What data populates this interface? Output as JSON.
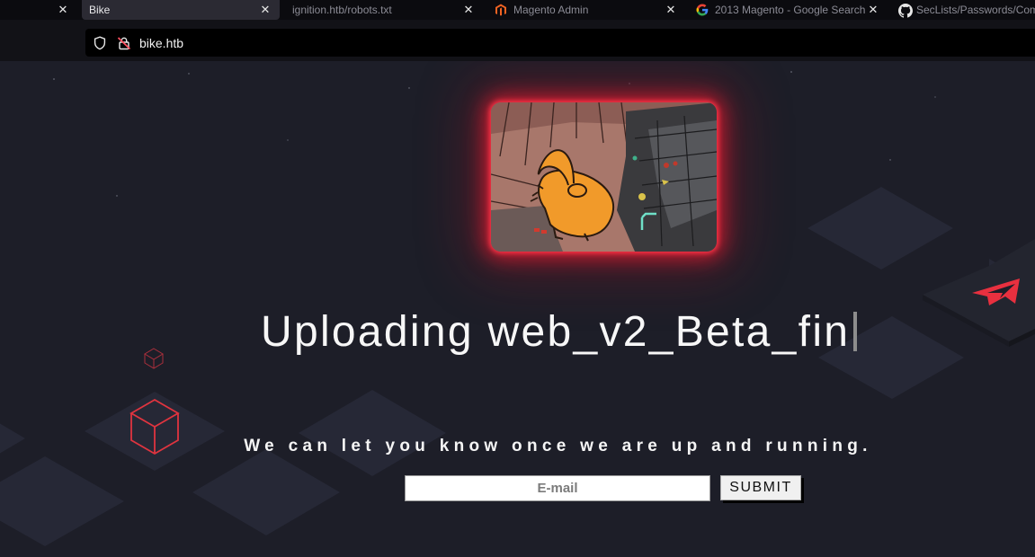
{
  "browser": {
    "tabs": [
      {
        "label": "Bike",
        "active": true,
        "favicon": "none"
      },
      {
        "label": "ignition.htb/robots.txt",
        "active": false,
        "favicon": "none"
      },
      {
        "label": "Magento Admin",
        "active": false,
        "favicon": "magento-icon"
      },
      {
        "label": "2013 Magento - Google Search",
        "active": false,
        "favicon": "google-icon"
      },
      {
        "label": "SecLists/Passwords/Com",
        "active": false,
        "favicon": "github-icon"
      }
    ],
    "url": "bike.htb",
    "icons": {
      "shield": "shield-icon",
      "lock": "insecure-lock-icon"
    },
    "accent_color": "#e8303f"
  },
  "page": {
    "headline": "Uploading web_v2_Beta_fin",
    "tagline": "We can let you know once we are up and running.",
    "email_placeholder": "E-mail",
    "email_value": "",
    "submit_label": "SUBMIT"
  }
}
